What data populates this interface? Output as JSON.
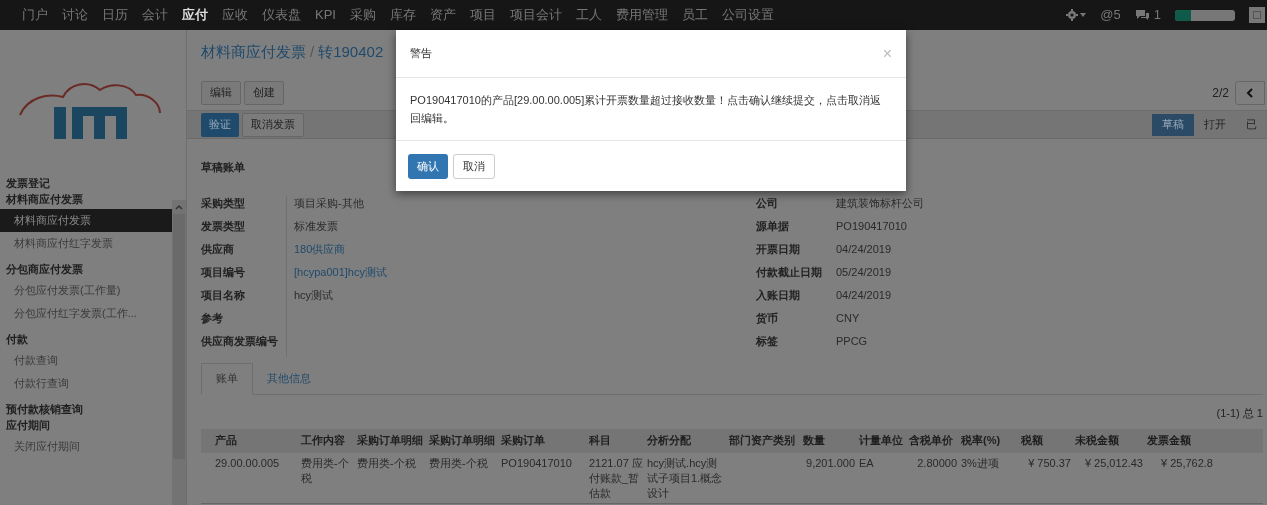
{
  "top_menu": [
    {
      "label": "门户",
      "selected": false
    },
    {
      "label": "讨论",
      "selected": false
    },
    {
      "label": "日历",
      "selected": false
    },
    {
      "label": "会计",
      "selected": false
    },
    {
      "label": "应付",
      "selected": true
    },
    {
      "label": "应收",
      "selected": false
    },
    {
      "label": "仪表盘",
      "selected": false
    },
    {
      "label": "KPI",
      "selected": false
    },
    {
      "label": "采购",
      "selected": false
    },
    {
      "label": "库存",
      "selected": false
    },
    {
      "label": "资产",
      "selected": false
    },
    {
      "label": "项目",
      "selected": false
    },
    {
      "label": "项目会计",
      "selected": false
    },
    {
      "label": "工人",
      "selected": false
    },
    {
      "label": "费用管理",
      "selected": false
    },
    {
      "label": "员工",
      "selected": false
    },
    {
      "label": "公司设置",
      "selected": false
    }
  ],
  "top_right": {
    "mentions": "@5",
    "messages": "1",
    "progress": {
      "level": 0.27
    }
  },
  "sidebar": [
    {
      "label": "发票登记"
    },
    {
      "label": "材料商应付发票",
      "children": [
        {
          "label": "材料商应付发票",
          "selected": true
        },
        {
          "label": "材料商应付红字发票",
          "selected": false
        }
      ]
    },
    {
      "label": "分包商应付发票",
      "children": [
        {
          "label": "分包应付发票(工作量)",
          "selected": false
        },
        {
          "label": "分包应付红字发票(工作...",
          "selected": false
        }
      ]
    },
    {
      "label": "付款",
      "children": [
        {
          "label": "付款查询",
          "selected": false
        },
        {
          "label": "付款行查询",
          "selected": false
        }
      ]
    },
    {
      "label": "预付款核销查询"
    },
    {
      "label": "应付期间",
      "children": [
        {
          "label": "关闭应付期间",
          "selected": false
        }
      ]
    }
  ],
  "breadcrumb": {
    "parent": "材料商应付发票",
    "separator": "/",
    "current": "转190402"
  },
  "buttons": [
    "编辑",
    "创建"
  ],
  "pager": "2/2",
  "actions": [
    {
      "label": "验证",
      "primary": true
    },
    {
      "label": "取消发票",
      "primary": false
    }
  ],
  "stages": [
    {
      "label": "草稿",
      "selected": true
    },
    {
      "label": "打开",
      "selected": false
    },
    {
      "label": "已",
      "selected": false
    }
  ],
  "form_title": "草稿账单",
  "left_fields": [
    {
      "label": "采购类型",
      "value": "项目采购-其他",
      "link": false
    },
    {
      "label": "发票类型",
      "value": "标准发票",
      "link": false
    },
    {
      "label": "供应商",
      "value": "180供应商",
      "link": true
    },
    {
      "label": "项目编号",
      "value": "[hcypa001]hcy测试",
      "link": true
    },
    {
      "label": "项目名称",
      "value": "hcy测试",
      "link": false
    },
    {
      "label": "参考"
    },
    {
      "label": "供应商发票编号"
    }
  ],
  "right_fields": [
    {
      "label": "公司",
      "value": "建筑装饰标杆公司"
    },
    {
      "label": "源单据",
      "value": "PO190417010"
    },
    {
      "label": "开票日期",
      "value": "04/24/2019"
    },
    {
      "label": "付款截止日期",
      "value": "05/24/2019"
    },
    {
      "label": "入账日期",
      "value": "04/24/2019"
    },
    {
      "label": "货币",
      "value": "CNY"
    },
    {
      "label": "标签",
      "value": "PPCG"
    }
  ],
  "tabs": [
    {
      "label": "账单",
      "selected": true
    },
    {
      "label": "其他信息",
      "selected": false
    }
  ],
  "record_count": "(1-1) 总 1",
  "table": {
    "columns": [
      "产品",
      "工作内容",
      "采购订单明细",
      "采购订单明细",
      "采购订单",
      "科目",
      "分析分配",
      "部门",
      "资产类别",
      "数量",
      "计量单位",
      "含税单价",
      "税率(%)",
      "税额",
      "未税金额",
      "发票金额"
    ],
    "rows": [
      [
        "29.00.00.005",
        "费用类-个税",
        "费用类-个税",
        "费用类-个税",
        "PO190417010",
        "2121.07 应付账款_暂估款",
        "hcy测试.hcy测试子项目1.概念设计",
        "",
        "",
        "9,201.000",
        "EA",
        "2.80000",
        "3%进项",
        "¥ 750.37",
        "¥ 25,012.43",
        "¥ 25,762.8"
      ]
    ]
  },
  "dialog": {
    "title": "警告",
    "close": "×",
    "message": "PO190417010的产品[29.00.00.005]累计开票数量超过接收数量！点击确认继续提交，点击取消返回编辑。",
    "buttons": [
      {
        "label": "确认",
        "primary": true
      },
      {
        "label": "取消",
        "primary": false
      }
    ]
  }
}
